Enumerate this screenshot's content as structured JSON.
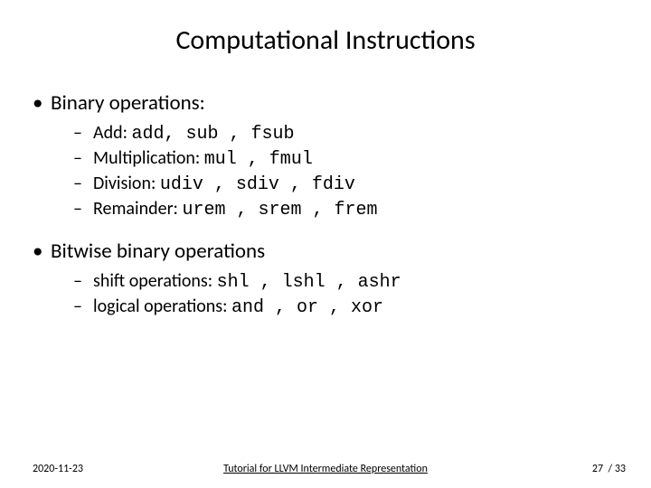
{
  "title": "Computational Instructions",
  "sections": [
    {
      "heading": "Binary operations:",
      "items": [
        {
          "label": "Add:",
          "codes": "add, sub , fsub"
        },
        {
          "label": "Multiplication:",
          "codes": "mul , fmul"
        },
        {
          "label": "Division:",
          "codes": "udiv , sdiv , fdiv"
        },
        {
          "label": "Remainder:",
          "codes": "urem , srem , frem"
        }
      ]
    },
    {
      "heading": "Bitwise binary operations",
      "items": [
        {
          "label": "shift operations:",
          "codes": "shl , lshl , ashr"
        },
        {
          "label": "logical operations:",
          "codes": "and , or , xor"
        }
      ]
    }
  ],
  "footer": {
    "date": "2020-11-23",
    "subtitle": "Tutorial for LLVM Intermediate Representation",
    "page_current": "27",
    "page_sep": "  / ",
    "page_total": "33"
  }
}
